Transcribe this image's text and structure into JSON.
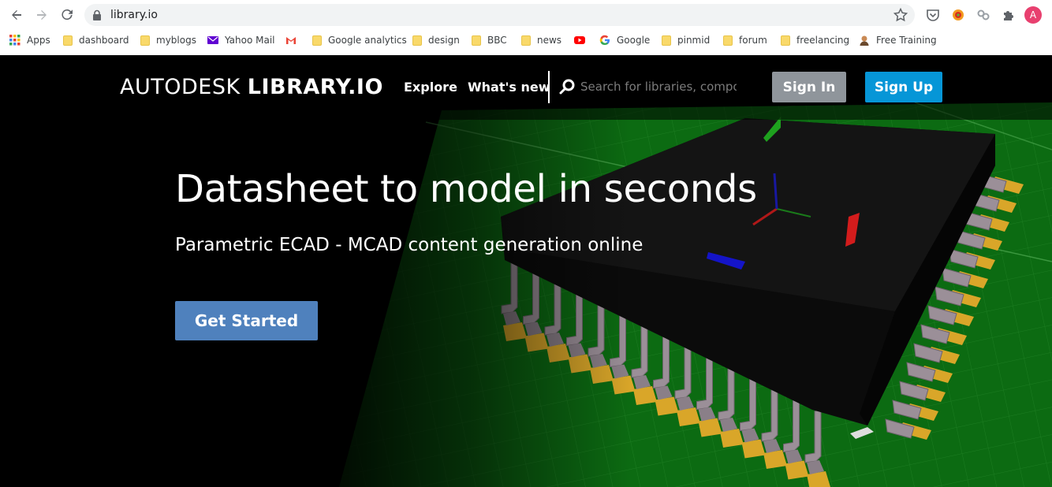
{
  "browser": {
    "url": "library.io",
    "avatar_letter": "A",
    "bookmarks": [
      {
        "label": "Apps",
        "icon": "apps-grid-icon"
      },
      {
        "label": "dashboard",
        "icon": "folder-icon"
      },
      {
        "label": "myblogs",
        "icon": "folder-icon"
      },
      {
        "label": "Yahoo Mail",
        "icon": "yahoo-mail-icon"
      },
      {
        "label": "",
        "icon": "gmail-icon"
      },
      {
        "label": "Google analytics",
        "icon": "folder-icon"
      },
      {
        "label": "design",
        "icon": "folder-icon"
      },
      {
        "label": "BBC",
        "icon": "folder-icon"
      },
      {
        "label": "news",
        "icon": "folder-icon"
      },
      {
        "label": "",
        "icon": "youtube-icon"
      },
      {
        "label": "Google",
        "icon": "google-icon"
      },
      {
        "label": "pinmid",
        "icon": "folder-icon"
      },
      {
        "label": "forum",
        "icon": "folder-icon"
      },
      {
        "label": "freelancing",
        "icon": "folder-icon"
      },
      {
        "label": "Free Training",
        "icon": "person-icon"
      }
    ]
  },
  "site": {
    "logo_light": "AUTODESK ",
    "logo_bold": "LIBRARY.IO",
    "nav": {
      "explore": "Explore",
      "whats_new": "What's new"
    },
    "search": {
      "placeholder": "Search for libraries, components..."
    },
    "sign_in": "Sign In",
    "sign_up": "Sign Up"
  },
  "hero": {
    "title": "Datasheet to model in seconds",
    "subtitle": "Parametric ECAD - MCAD content generation online",
    "cta": "Get Started"
  },
  "colors": {
    "sign_in_bg": "#8f959b",
    "sign_up_bg": "#0696d7",
    "cta_bg": "#4f81bd",
    "pcb_green": "#0c6b12",
    "pad_gold": "#d9a629",
    "pin_color": "#9b8f98"
  }
}
